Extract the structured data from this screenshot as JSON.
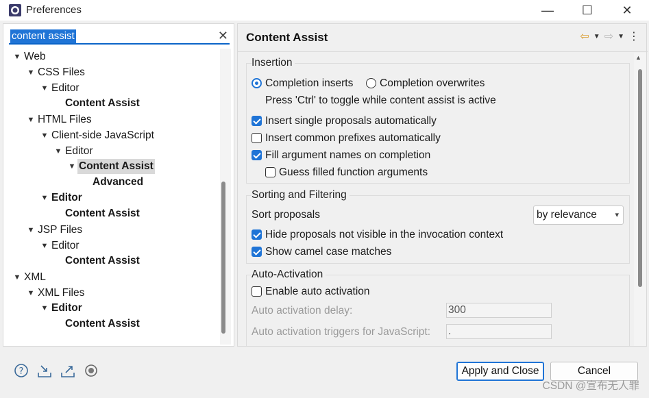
{
  "window": {
    "title": "Preferences",
    "minimize": "—",
    "maximize": "☐",
    "close": "✕"
  },
  "filter": {
    "value": "content assist",
    "clear": "✕"
  },
  "tree": [
    {
      "label": "Web",
      "bold": false,
      "twisty": "open"
    },
    {
      "label": "CSS Files",
      "bold": false,
      "twisty": "open"
    },
    {
      "label": "Editor",
      "bold": false,
      "twisty": "open"
    },
    {
      "label": "Content Assist",
      "bold": true,
      "twisty": "none"
    },
    {
      "label": "HTML Files",
      "bold": false,
      "twisty": "open"
    },
    {
      "label": "Client-side JavaScript",
      "bold": false,
      "twisty": "open"
    },
    {
      "label": "Editor",
      "bold": false,
      "twisty": "open"
    },
    {
      "label": "Content Assist",
      "bold": true,
      "twisty": "open",
      "selected": true
    },
    {
      "label": "Advanced",
      "bold": true,
      "twisty": "none"
    },
    {
      "label": "Editor",
      "bold": true,
      "twisty": "open"
    },
    {
      "label": "Content Assist",
      "bold": true,
      "twisty": "none"
    },
    {
      "label": "JSP Files",
      "bold": false,
      "twisty": "open"
    },
    {
      "label": "Editor",
      "bold": false,
      "twisty": "open"
    },
    {
      "label": "Content Assist",
      "bold": true,
      "twisty": "none"
    },
    {
      "label": "XML",
      "bold": false,
      "twisty": "open"
    },
    {
      "label": "XML Files",
      "bold": false,
      "twisty": "open"
    },
    {
      "label": "Editor",
      "bold": true,
      "twisty": "open"
    },
    {
      "label": "Content Assist",
      "bold": true,
      "twisty": "none"
    }
  ],
  "page": {
    "title": "Content Assist",
    "back_icon": "⇦",
    "forward_icon": "⇨",
    "menu_icon": "⋮"
  },
  "insertion": {
    "title": "Insertion",
    "completion_inserts": "Completion inserts",
    "completion_overwrites": "Completion overwrites",
    "insert_mode": "inserts",
    "toggle_hint": "Press 'Ctrl' to toggle while content assist is active",
    "single_proposals": {
      "label": "Insert single proposals automatically",
      "checked": true
    },
    "common_prefixes": {
      "label": "Insert common prefixes automatically",
      "checked": false
    },
    "fill_argument_names": {
      "label": "Fill argument names on completion",
      "checked": true
    },
    "guess_arguments": {
      "label": "Guess filled function arguments",
      "checked": false
    }
  },
  "sorting": {
    "title": "Sorting and Filtering",
    "sort_label": "Sort proposals",
    "sort_value": "by relevance",
    "hide_not_visible": {
      "label": "Hide proposals not visible in the invocation context",
      "checked": true
    },
    "camel_case": {
      "label": "Show camel case matches",
      "checked": true
    }
  },
  "auto_activation": {
    "title": "Auto-Activation",
    "enable": {
      "label": "Enable auto activation",
      "checked": false
    },
    "delay_label": "Auto activation delay:",
    "delay_value": "300",
    "triggers_label": "Auto activation triggers for JavaScript:",
    "triggers_value": "."
  },
  "buttons": {
    "apply_close": "Apply and Close",
    "cancel": "Cancel"
  },
  "bottom_icons": [
    "help-icon",
    "import-icon",
    "export-icon",
    "record-icon"
  ],
  "watermark": "CSDN @宣布无人罪",
  "colors": {
    "accent": "#1f74d6",
    "selection": "#d9d9d9"
  }
}
